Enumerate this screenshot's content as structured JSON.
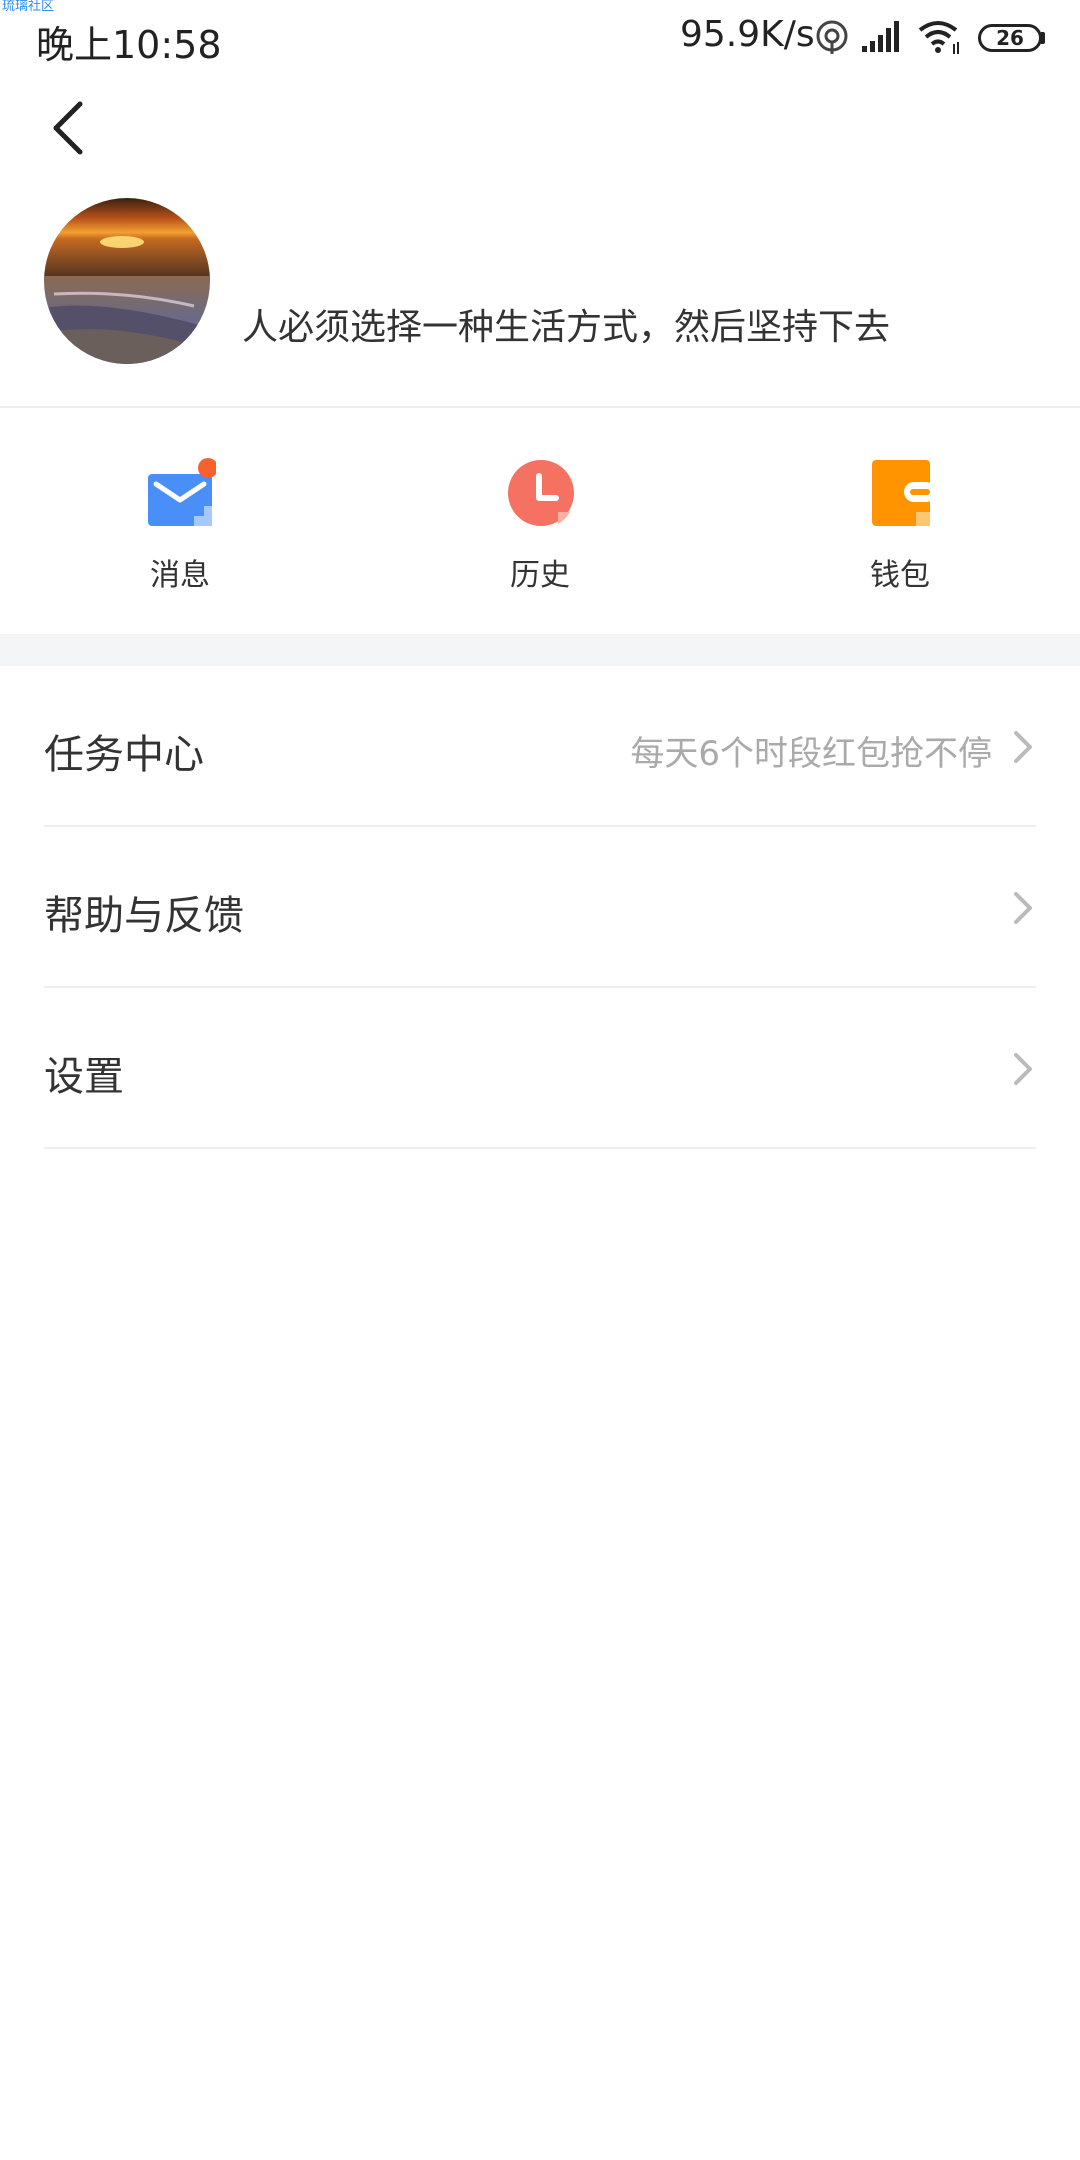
{
  "watermark": "琉璃社区",
  "status_bar": {
    "time": "晚上10:58",
    "net_speed": "95.9K/s",
    "battery": "26",
    "icons": [
      "hotspot-icon",
      "signal-icon",
      "wifi-icon",
      "battery-icon"
    ]
  },
  "profile": {
    "motto": "人必须选择一种生活方式，然后坚持下去"
  },
  "quick_actions": [
    {
      "label": "消息",
      "icon": "mail-icon",
      "color": "#4a8ff7",
      "badge": true,
      "badge_color": "#f5622d"
    },
    {
      "label": "历史",
      "icon": "clock-icon",
      "color": "#f57162"
    },
    {
      "label": "钱包",
      "icon": "wallet-icon",
      "color": "#ff9300"
    }
  ],
  "menu": [
    {
      "label": "任务中心",
      "hint": "每天6个时段红包抢不停"
    },
    {
      "label": "帮助与反馈",
      "hint": ""
    },
    {
      "label": "设置",
      "hint": ""
    }
  ]
}
